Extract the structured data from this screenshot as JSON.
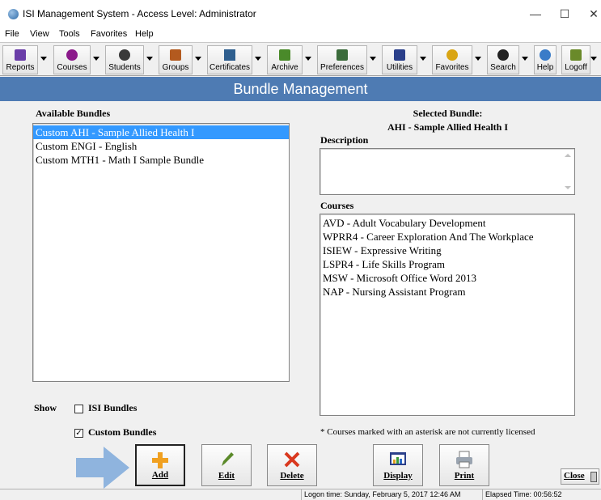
{
  "window": {
    "title": "ISI Management System - Access Level: Administrator",
    "minimize": "—",
    "maximize": "☐",
    "close": "✕"
  },
  "menu": [
    "File",
    "View",
    "Tools",
    "Favorites",
    "Help"
  ],
  "toolbar": [
    {
      "label": "Reports",
      "icon": "reports-icon",
      "color": "#6a3da8"
    },
    {
      "label": "Courses",
      "icon": "courses-icon",
      "color": "#8b1a8b"
    },
    {
      "label": "Students",
      "icon": "students-icon",
      "color": "#3a3a3a"
    },
    {
      "label": "Groups",
      "icon": "groups-icon",
      "color": "#b35a1f"
    },
    {
      "label": "Certificates",
      "icon": "certificates-icon",
      "color": "#2f5f8f"
    },
    {
      "label": "Archive",
      "icon": "archive-icon",
      "color": "#4a8a2a"
    },
    {
      "label": "Preferences",
      "icon": "preferences-icon",
      "color": "#3b6b3b"
    },
    {
      "label": "Utilities",
      "icon": "utilities-icon",
      "color": "#2a3f8a"
    },
    {
      "label": "Favorites",
      "icon": "favorites-icon",
      "color": "#d9a514"
    },
    {
      "label": "Search",
      "icon": "search-icon",
      "color": "#222222"
    },
    {
      "label": "Help",
      "icon": "help-icon",
      "color": "#3a7cc8"
    },
    {
      "label": "Logoff",
      "icon": "logoff-icon",
      "color": "#6a8a2a"
    }
  ],
  "banner": "Bundle Management",
  "available": {
    "heading": "Available Bundles",
    "items": [
      {
        "label": "Custom  AHI - Sample Allied Health I",
        "selected": true
      },
      {
        "label": "Custom  ENGI - English",
        "selected": false
      },
      {
        "label": "Custom  MTH1 - Math I Sample Bundle",
        "selected": false
      }
    ]
  },
  "selected": {
    "heading": "Selected Bundle:",
    "name": "AHI - Sample Allied Health I",
    "description_label": "Description",
    "description_value": "",
    "courses_label": "Courses",
    "courses": [
      "AVD - Adult Vocabulary Development",
      "WPRR4 - Career Exploration And The Workplace",
      "ISIEW - Expressive Writing",
      "LSPR4 - Life Skills Program",
      "MSW - Microsoft Office Word 2013",
      "NAP - Nursing Assistant Program"
    ],
    "footnote": "* Courses marked with an asterisk are not currently licensed"
  },
  "show": {
    "label": "Show",
    "isi_label": "ISI Bundles",
    "isi_checked": false,
    "custom_label": "Custom Bundles",
    "custom_checked": true
  },
  "buttons": {
    "add": "Add",
    "edit": "Edit",
    "delete": "Delete",
    "display": "Display",
    "print": "Print",
    "close": "Close"
  },
  "status": {
    "logon": "Logon time: Sunday, February 5, 2017 12:46 AM",
    "elapsed": "Elapsed Time: 00:56:52"
  },
  "colors": {
    "banner": "#4e7bb3",
    "selection": "#3399ff",
    "arrow": "#8fb4de"
  }
}
